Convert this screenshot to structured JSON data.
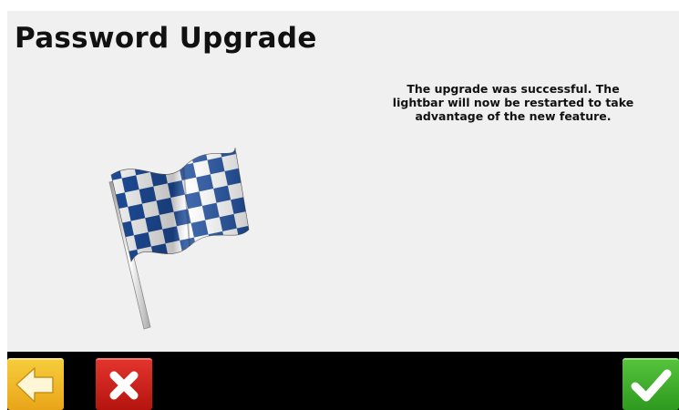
{
  "header": {
    "title": "Password Upgrade"
  },
  "message": {
    "lines": [
      "The upgrade was successful. The",
      "lightbar will now be restarted to take",
      "advantage of the new feature."
    ]
  },
  "illustration": {
    "icon": "checkered-flag-icon",
    "colors": {
      "checker": "#1f4f9e",
      "pole": "#e6e6e6"
    }
  },
  "toolbar": {
    "back": {
      "icon": "arrow-left-icon",
      "color": "#f0b82a"
    },
    "cancel": {
      "icon": "close-x-icon",
      "color": "#d4261f"
    },
    "confirm": {
      "icon": "checkmark-icon",
      "color": "#3db02a"
    }
  }
}
